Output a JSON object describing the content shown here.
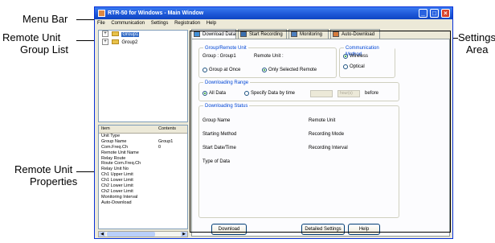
{
  "callouts": {
    "menu_bar": "Menu Bar",
    "group_list": [
      "Remote Unit",
      "Group List"
    ],
    "properties": [
      "Remote Unit",
      "Properties"
    ],
    "settings": [
      "Settings",
      "Area"
    ]
  },
  "window": {
    "title": "RTR-50 for Windows - Main Window"
  },
  "menu": [
    "File",
    "Communication",
    "Settings",
    "Registration",
    "Help"
  ],
  "tree": {
    "items": [
      {
        "label": "Group1",
        "expander": "+"
      },
      {
        "label": "Group2",
        "expander": "+"
      }
    ]
  },
  "properties": {
    "col_item": "Item",
    "col_contents": "Contents",
    "rows": [
      {
        "k": "Unit Type",
        "v": ""
      },
      {
        "k": "Group Name",
        "v": "Group1"
      },
      {
        "k": "Com.Freq.Ch",
        "v": "0"
      },
      {
        "k": "Remote Unit Name",
        "v": ""
      },
      {
        "k": "Relay Route",
        "v": ""
      },
      {
        "k": "Route Com.Freq.Ch",
        "v": ""
      },
      {
        "k": "Relay Unit No",
        "v": ""
      },
      {
        "k": "Ch1 Upper Limit",
        "v": ""
      },
      {
        "k": "Ch1 Lower Limit",
        "v": ""
      },
      {
        "k": "Ch2 Lower Limit",
        "v": ""
      },
      {
        "k": "Ch2 Lower Limit",
        "v": ""
      },
      {
        "k": "Monitoring Interval",
        "v": ""
      },
      {
        "k": "Auto-Download",
        "v": ""
      }
    ]
  },
  "tabs": [
    "Download Data",
    "Start Recording",
    "Monitoring",
    "Auto-Download"
  ],
  "panel": {
    "group_unit": {
      "legend": "Group/Remote Unit",
      "group_label": "Group : Group1",
      "remote_label": "Remote Unit :",
      "radio_all": "Group at Once",
      "radio_selected": "Only Selected Remote"
    },
    "comm": {
      "legend": "Communication Method",
      "wireless": "Wireless",
      "optical": "Optical"
    },
    "range": {
      "legend": "Downloading Range",
      "all_data": "All Data",
      "specify": "Specify Data by time",
      "unit": "hour(s)",
      "before": "before"
    },
    "status": {
      "legend": "Downloading Status",
      "left": [
        "Group Name",
        "Starting Method",
        "Start Date/Time",
        "Type of Data"
      ],
      "right": [
        "Remote Unit",
        "Recording Mode",
        "Recording Interval"
      ]
    },
    "buttons": {
      "download": "Download",
      "detailed": "Detailed Settings",
      "help": "Help"
    }
  }
}
